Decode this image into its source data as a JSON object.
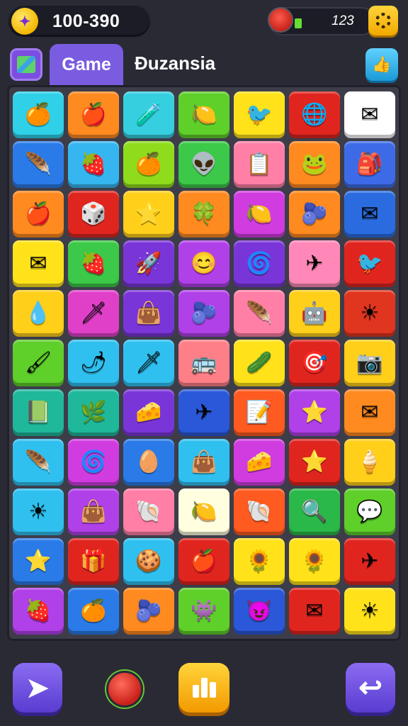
{
  "top_bar": {
    "coins": "100-390",
    "coin_icon": "coin-icon",
    "energy_value": "123",
    "energy_icon": "bomb-icon",
    "settings_icon": "gear-icon"
  },
  "header": {
    "map_icon": "map-icon",
    "tab_active": "Game",
    "tab_other": "Đuzansia",
    "like_icon": "thumbs-up-icon"
  },
  "board": {
    "rows": [
      [
        {
          "color": "#2fd0e8",
          "icon": "🍊"
        },
        {
          "color": "#ff8a1f",
          "icon": "🍎"
        },
        {
          "color": "#35cfe0",
          "icon": "🧪"
        },
        {
          "color": "#5fcf2a",
          "icon": "🍋"
        },
        {
          "color": "#ffe21a",
          "icon": "🐦"
        },
        {
          "color": "#e0251f",
          "icon": "🌐"
        },
        {
          "color": "#ffffff",
          "icon": "✉"
        }
      ],
      [
        {
          "color": "#2a7be8",
          "icon": "🪶"
        },
        {
          "color": "#36b6f0",
          "icon": "🍓"
        },
        {
          "color": "#8fdc1c",
          "icon": "🍊"
        },
        {
          "color": "#3cc848",
          "icon": "👽"
        },
        {
          "color": "#ff7fa6",
          "icon": "📋"
        },
        {
          "color": "#ff8a1f",
          "icon": "🐸"
        },
        {
          "color": "#3d6be8",
          "icon": "🎒"
        }
      ],
      [
        {
          "color": "#ff8a1f",
          "icon": "🍎"
        },
        {
          "color": "#e0251f",
          "icon": "🎲"
        },
        {
          "color": "#ffcf1a",
          "icon": "⭐"
        },
        {
          "color": "#ff8a1f",
          "icon": "🍀"
        },
        {
          "color": "#d03ce0",
          "icon": "🍋"
        },
        {
          "color": "#ff8a1f",
          "icon": "🫐"
        },
        {
          "color": "#2a6ce0",
          "icon": "✉"
        }
      ],
      [
        {
          "color": "#ffe21a",
          "icon": "✉"
        },
        {
          "color": "#3cc848",
          "icon": "🍓"
        },
        {
          "color": "#7a35d8",
          "icon": "🚀"
        },
        {
          "color": "#b040e8",
          "icon": "😊"
        },
        {
          "color": "#7a35d8",
          "icon": "🌀"
        },
        {
          "color": "#ff88b8",
          "icon": "✈"
        },
        {
          "color": "#e0251f",
          "icon": "🐦"
        }
      ],
      [
        {
          "color": "#ffcf1a",
          "icon": "💧"
        },
        {
          "color": "#e040c8",
          "icon": "🗡"
        },
        {
          "color": "#7a35d8",
          "icon": "👜"
        },
        {
          "color": "#b040e8",
          "icon": "🫐"
        },
        {
          "color": "#ff7fa6",
          "icon": "🪶"
        },
        {
          "color": "#ffcf1a",
          "icon": "🤖"
        },
        {
          "color": "#e0351f",
          "icon": "☀"
        }
      ],
      [
        {
          "color": "#5fcf2a",
          "icon": "🖌"
        },
        {
          "color": "#2fc0f0",
          "icon": "🌶"
        },
        {
          "color": "#2fc0f0",
          "icon": "🗡"
        },
        {
          "color": "#ff7f88",
          "icon": "🚌"
        },
        {
          "color": "#ffe21a",
          "icon": "🥒"
        },
        {
          "color": "#e0251f",
          "icon": "🎯"
        },
        {
          "color": "#ffcf1a",
          "icon": "📷"
        }
      ],
      [
        {
          "color": "#1fb89a",
          "icon": "📗"
        },
        {
          "color": "#1fb89a",
          "icon": "🌿"
        },
        {
          "color": "#7a35d8",
          "icon": "🧀"
        },
        {
          "color": "#2a58d8",
          "icon": "✈"
        },
        {
          "color": "#ff5a1f",
          "icon": "📝"
        },
        {
          "color": "#b040e8",
          "icon": "⭐"
        },
        {
          "color": "#ff8a1f",
          "icon": "✉"
        }
      ],
      [
        {
          "color": "#2fc0f0",
          "icon": "🪶"
        },
        {
          "color": "#d03ce0",
          "icon": "🌀"
        },
        {
          "color": "#2a7be8",
          "icon": "🥚"
        },
        {
          "color": "#2fc0f0",
          "icon": "👜"
        },
        {
          "color": "#d03ce0",
          "icon": "🧀"
        },
        {
          "color": "#e0251f",
          "icon": "⭐"
        },
        {
          "color": "#ffcf1a",
          "icon": "🍦"
        }
      ],
      [
        {
          "color": "#2fc0f0",
          "icon": "☀"
        },
        {
          "color": "#b040e8",
          "icon": "👜"
        },
        {
          "color": "#ff7fa6",
          "icon": "🐚"
        },
        {
          "color": "#ffffe0",
          "icon": "🍋"
        },
        {
          "color": "#ff5a1f",
          "icon": "🐚"
        },
        {
          "color": "#2ab848",
          "icon": "🔍"
        },
        {
          "color": "#5fcf2a",
          "icon": "💬"
        }
      ],
      [
        {
          "color": "#2a7be8",
          "icon": "⭐"
        },
        {
          "color": "#e0251f",
          "icon": "🎁"
        },
        {
          "color": "#2fc0f0",
          "icon": "🍪"
        },
        {
          "color": "#e0251f",
          "icon": "🍎"
        },
        {
          "color": "#ffe21a",
          "icon": "🌻"
        },
        {
          "color": "#ffe21a",
          "icon": "🌻"
        },
        {
          "color": "#e0251f",
          "icon": "✈"
        }
      ],
      [
        {
          "color": "#b040e8",
          "icon": "🍓"
        },
        {
          "color": "#2a7be8",
          "icon": "🍊"
        },
        {
          "color": "#ff8a1f",
          "icon": "🫐"
        },
        {
          "color": "#5fcf2a",
          "icon": "👾"
        },
        {
          "color": "#2a58d8",
          "icon": "😈"
        },
        {
          "color": "#e0251f",
          "icon": "✉"
        },
        {
          "color": "#ffe21a",
          "icon": "☀"
        }
      ]
    ]
  },
  "bottom_bar": {
    "back_icon": "cursor-arrow-icon",
    "bomb_icon": "bomb-icon",
    "leaderboard_icon": "bar-chart-icon",
    "next_icon": "undo-arrow-icon"
  }
}
